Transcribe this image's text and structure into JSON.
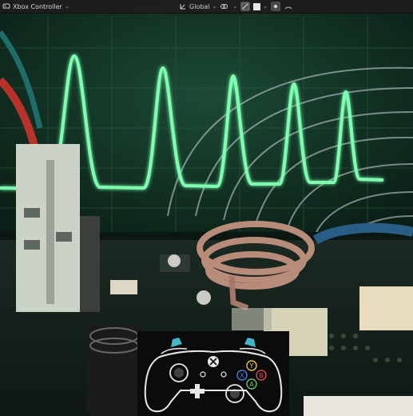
{
  "header": {
    "object_selector": {
      "label": "Xbox Controller",
      "icon": "gamepad-icon"
    },
    "transform_orientation": {
      "label": "Global",
      "icon": "orientation-axes-icon"
    },
    "tools": [
      {
        "name": "snap-pivot-icon"
      },
      {
        "name": "snap-toggle-icon"
      },
      {
        "name": "proportional-edit-icon"
      },
      {
        "name": "overlay-toggle-icon"
      }
    ]
  },
  "controller_overlay": {
    "buttons": [
      "Y",
      "B",
      "X",
      "A"
    ],
    "colors": {
      "Y": "#e6c54a",
      "B": "#e04a4a",
      "X": "#4a7ae0",
      "A": "#6ac26a",
      "triggers": "#3fb8c9",
      "outline": "#e8e8e8"
    }
  },
  "scene": {
    "colors": {
      "waveform": "#7dffb0",
      "screen": "#0f2a1e",
      "board": "#121c18",
      "coil": "#b98c7a"
    }
  }
}
